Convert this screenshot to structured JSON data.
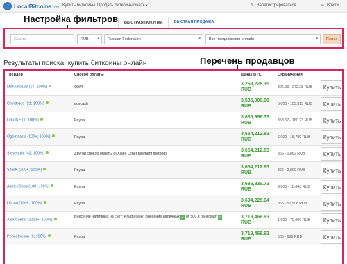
{
  "nav": {
    "logo": "LocalBitcoins",
    "logo_suffix": ".com",
    "buy_link": "Купить биткоины",
    "sell_link": "Продать биткоины",
    "learn_link": "Узнать",
    "learn_caret": "▾",
    "register": "Зарегистрироваться",
    "login": "Войти"
  },
  "tabs": {
    "buy": "БЫСТРАЯ ПОКУПКА",
    "sell": "БЫСТРАЯ ПРОДАЖА"
  },
  "annotations": {
    "filters": "Настройка фильтров",
    "sellers": "Перечень продавцов"
  },
  "filters": {
    "amount_placeholder": "Сумма",
    "currency": "RUB",
    "country": "Russian Federation",
    "offers": "Все предложения онлайн",
    "search_button": "Поиск"
  },
  "results_title": "Результаты поиска: купить биткоины онлайн",
  "table": {
    "headers": {
      "trader": "Трейдер",
      "payment": "Способ оплаты",
      "price": "Цена / BTC",
      "limits": "Ограничения"
    },
    "buy_label": "Купить",
    "rows": [
      {
        "trader": "Mankelo123 (17; 100%)",
        "status": "gray",
        "payment": "QIWI",
        "price": "3,269,228.35",
        "currency": "RUB",
        "limits": "326.93 - 272.28 RUB"
      },
      {
        "trader": "Cointtrade (21; 100%)",
        "status": "green",
        "payment": "advcash",
        "price": "3,535,000.00",
        "currency": "RUB",
        "limits": "5,000 - 155,313 RUB"
      },
      {
        "trader": "LinuxKE (7; 100%)",
        "status": "green",
        "payment": "Paypal",
        "price": "3,685,696.33",
        "currency": "RUB",
        "limits": "358.57 - 160.23 RUB"
      },
      {
        "trader": "Ogomaasis (100+; 100%)",
        "status": "green",
        "payment": "Paypal",
        "price": "3,654,212.83",
        "currency": "RUB",
        "limits": "6,000 - 15,789 RUB"
      },
      {
        "trader": "Stevebully (42; 100%)",
        "status": "green",
        "payment": "Другой способ оплаты онлайн: Other payment methods",
        "price": "3,654,212.83",
        "currency": "RUB",
        "limits": "366 - 1,862 RUB"
      },
      {
        "trader": "SilasK (200+; 100%)",
        "status": "green",
        "payment": "Paypal",
        "price": "3,654,212.83",
        "currency": "RUB",
        "limits": "366 - 2,000 RUB"
      },
      {
        "trader": "AshleyOops (100+; 96%)",
        "status": "green",
        "payment": "Paypal",
        "price": "3,686,839.73",
        "currency": "RUB",
        "limits": "9,000 - 18,843 RUB"
      },
      {
        "trader": "Liscaa (700+; 100%)",
        "status": "green",
        "payment": "Paypal",
        "price": "3,694,228.04",
        "currency": "RUB",
        "limits": "366 - 50,508 RUB"
      },
      {
        "trader": "Alex.trueno (2000+; 100%)",
        "status": "green",
        "payment": "Внесение наличных на счет: Альфабанк! Внесение наличных",
        "payment_extra": "от 500 в банкомат",
        "price": "3,719,466.63",
        "currency": "RUB",
        "limits": "1,000 - 70,000 RUB"
      },
      {
        "trader": "Princetheson (6; 100%)",
        "status": "green",
        "payment": "Paypal",
        "price": "3,719,466.63",
        "currency": "RUB",
        "limits": "500 - 689 RUB"
      }
    ]
  }
}
